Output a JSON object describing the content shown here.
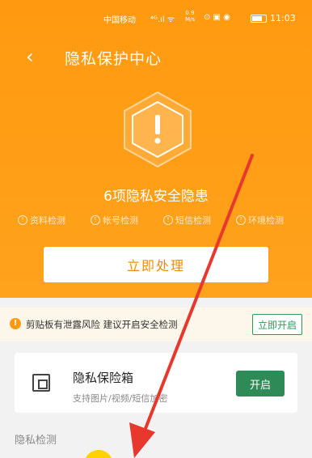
{
  "statusbar": {
    "carrier": "中国移动",
    "signal": "⁴ᴳ.ıl ᯤ",
    "speed": "0.9 M/s",
    "icons": "⊙ ▣ ◉",
    "time": "11:03"
  },
  "header": {
    "back_icon": "chevron-left",
    "title": "隐私保护中心",
    "risk_title": "6项隐私安全隐患",
    "checks": [
      {
        "label": "资料检测"
      },
      {
        "label": "帐号检测"
      },
      {
        "label": "短信检测"
      },
      {
        "label": "环境检测"
      }
    ],
    "handle_button": "立即处理"
  },
  "notice": {
    "text": "剪贴板有泄露风险 建议开启安全检测",
    "button": "立即开启"
  },
  "vault": {
    "title": "隐私保险箱",
    "subtitle": "支持图片/视频/短信加密",
    "button": "开启"
  },
  "section": {
    "label": "隐私检测"
  },
  "colors": {
    "header_orange": "#ff9a10",
    "accent_green": "#2e8b57",
    "annotation_red": "#e8382e"
  }
}
